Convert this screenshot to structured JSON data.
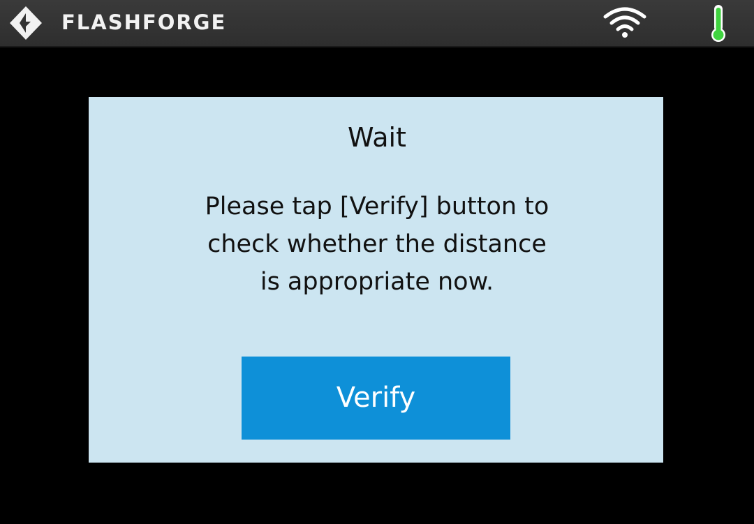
{
  "header": {
    "brand_name": "FLASHFORGE",
    "icons": [
      "flashforge-logo-icon",
      "wifi-icon",
      "thermometer-icon"
    ],
    "colors": {
      "bar": "#333333",
      "thermometer": "#3fd33f"
    }
  },
  "dialog": {
    "title": "Wait",
    "message_lines": [
      "Please tap [Verify] button to",
      "check whether the distance",
      "is appropriate now."
    ],
    "verify_label": "Verify",
    "colors": {
      "background": "#cce5f1",
      "button": "#0e90d8"
    }
  }
}
